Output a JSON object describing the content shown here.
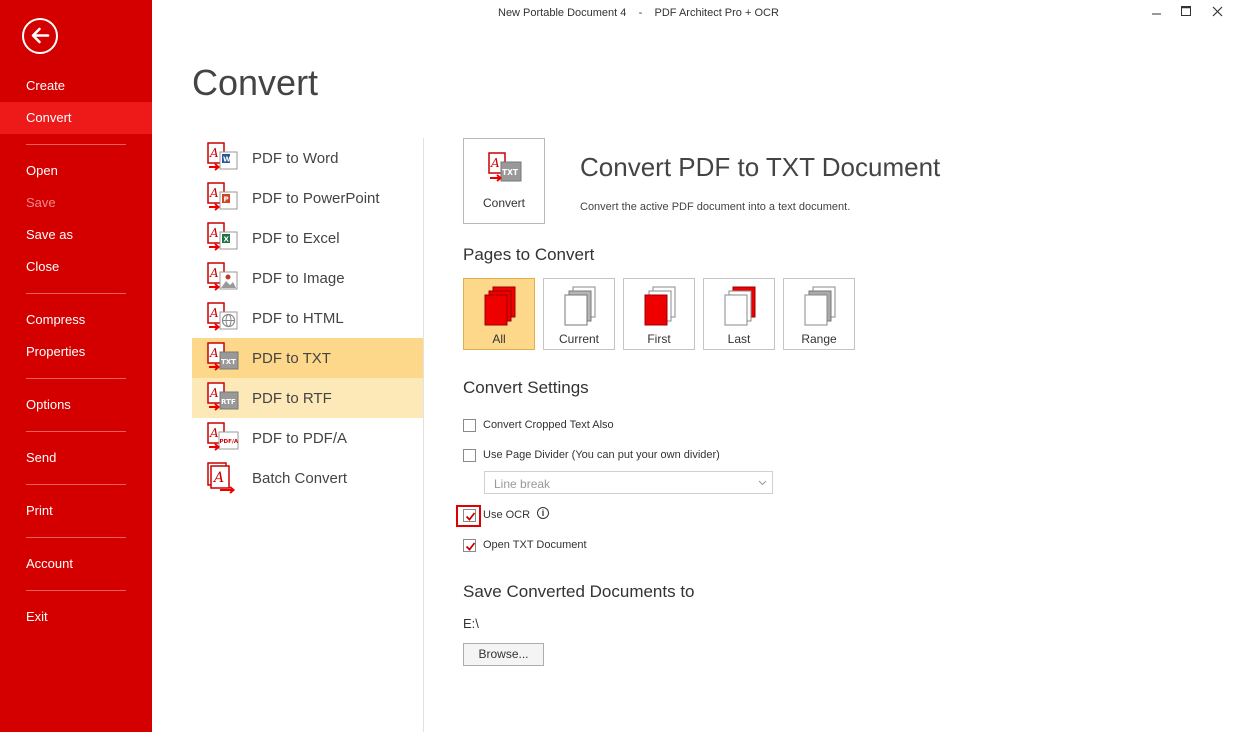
{
  "window": {
    "title": "New Portable Document 4    -    PDF Architect Pro + OCR",
    "controls": [
      "minimize-icon",
      "maximize-icon",
      "close-icon"
    ]
  },
  "sidebar": {
    "back_icon": "arrow-left-circle-icon",
    "items": [
      {
        "label": "Create",
        "state": "normal"
      },
      {
        "label": "Convert",
        "state": "active"
      },
      {
        "label": "Open",
        "state": "normal"
      },
      {
        "label": "Save",
        "state": "disabled"
      },
      {
        "label": "Save as",
        "state": "normal"
      },
      {
        "label": "Close",
        "state": "normal"
      },
      {
        "label": "Compress",
        "state": "normal"
      },
      {
        "label": "Properties",
        "state": "normal"
      },
      {
        "label": "Options",
        "state": "normal"
      },
      {
        "label": "Send",
        "state": "normal"
      },
      {
        "label": "Print",
        "state": "normal"
      },
      {
        "label": "Account",
        "state": "normal"
      },
      {
        "label": "Exit",
        "state": "normal"
      }
    ]
  },
  "page_title": "Convert",
  "convert_list": [
    {
      "label": "PDF to Word",
      "badge": "W",
      "badge_color": "#2b579a"
    },
    {
      "label": "PDF to PowerPoint",
      "badge": "P",
      "badge_color": "#d04423"
    },
    {
      "label": "PDF to Excel",
      "badge": "X",
      "badge_color": "#207245"
    },
    {
      "label": "PDF to Image",
      "badge": "img",
      "badge_color": "#c0392b"
    },
    {
      "label": "PDF to HTML",
      "badge": "html",
      "badge_color": "#888888"
    },
    {
      "label": "PDF to TXT",
      "badge": "TXT",
      "badge_color": "#777777"
    },
    {
      "label": "PDF to RTF",
      "badge": "RTF",
      "badge_color": "#777777"
    },
    {
      "label": "PDF to PDF/A",
      "badge": "PDF/A",
      "badge_color": "#c00000"
    },
    {
      "label": "Batch Convert",
      "badge": "",
      "badge_color": "#c00000"
    }
  ],
  "detail": {
    "convert_button": "Convert",
    "heading": "Convert PDF to TXT Document",
    "description": "Convert the active PDF document into a text document."
  },
  "pages_to_convert": {
    "heading": "Pages to Convert",
    "options": [
      {
        "label": "All",
        "selected": true
      },
      {
        "label": "Current",
        "selected": false
      },
      {
        "label": "First",
        "selected": false
      },
      {
        "label": "Last",
        "selected": false
      },
      {
        "label": "Range",
        "selected": false
      }
    ]
  },
  "convert_settings": {
    "heading": "Convert Settings",
    "cropped_text": {
      "label": "Convert Cropped Text Also",
      "checked": false
    },
    "page_divider": {
      "label": "Use Page Divider (You can put your own divider)",
      "checked": false
    },
    "divider_select": {
      "value": "Line break"
    },
    "use_ocr": {
      "label": "Use OCR",
      "checked": true,
      "info": "i"
    },
    "open_txt": {
      "label": "Open TXT Document",
      "checked": true
    }
  },
  "save_to": {
    "heading": "Save Converted Documents to",
    "path": "E:\\",
    "browse_label": "Browse..."
  },
  "colors": {
    "sidebar": "#d40000",
    "sidebar_active": "#ee1a1a",
    "selection": "#fdd88b",
    "hover": "#fde8b8",
    "accent_red": "#e00000"
  }
}
